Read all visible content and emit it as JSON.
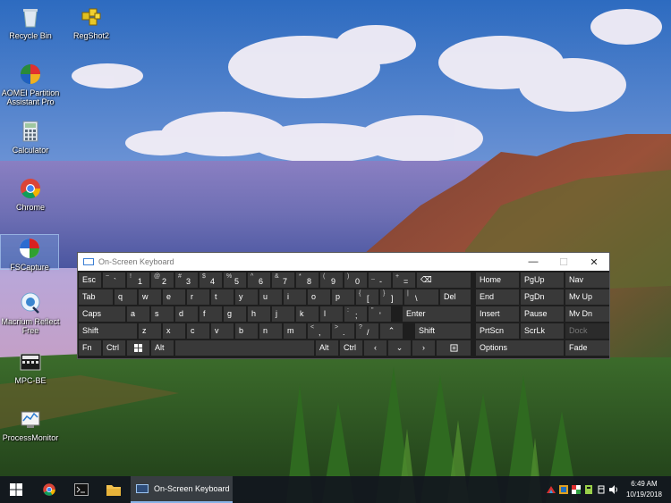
{
  "desktop": {
    "icons": [
      {
        "label": "Recycle Bin"
      },
      {
        "label": "RegShot2"
      },
      {
        "label": "AOMEI Partition Assistant Pro"
      },
      {
        "label": "Calculator"
      },
      {
        "label": "Chrome"
      },
      {
        "label": "FSCapture"
      },
      {
        "label": "Macrium Reflect Free"
      },
      {
        "label": "MPC-BE"
      },
      {
        "label": "ProcessMonitor"
      }
    ]
  },
  "osk": {
    "title": "On-Screen Keyboard",
    "minimize": "—",
    "maximize": "☐",
    "close": "✕",
    "row1": [
      {
        "shift": "~",
        "primary": "`"
      },
      {
        "shift": "!",
        "primary": "1"
      },
      {
        "shift": "@",
        "primary": "2"
      },
      {
        "shift": "#",
        "primary": "3"
      },
      {
        "shift": "$",
        "primary": "4"
      },
      {
        "shift": "%",
        "primary": "5"
      },
      {
        "shift": "^",
        "primary": "6"
      },
      {
        "shift": "&",
        "primary": "7"
      },
      {
        "shift": "*",
        "primary": "8"
      },
      {
        "shift": "(",
        "primary": "9"
      },
      {
        "shift": ")",
        "primary": "0"
      },
      {
        "shift": "_",
        "primary": "-"
      },
      {
        "shift": "+",
        "primary": "="
      }
    ],
    "esc": "Esc",
    "backspace": "⌫",
    "tab": "Tab",
    "row2": [
      "q",
      "w",
      "e",
      "r",
      "t",
      "y",
      "u",
      "i",
      "o",
      "p"
    ],
    "bracket_l": {
      "shift": "{",
      "primary": "["
    },
    "bracket_r": {
      "shift": "}",
      "primary": "]"
    },
    "backslash": {
      "shift": "|",
      "primary": "\\"
    },
    "del": "Del",
    "caps": "Caps",
    "row3": [
      "a",
      "s",
      "d",
      "f",
      "g",
      "h",
      "j",
      "k",
      "l"
    ],
    "semicolon": {
      "shift": ":",
      "primary": ";"
    },
    "quote": {
      "shift": "\"",
      "primary": "'"
    },
    "enter": "Enter",
    "shift": "Shift",
    "row4": [
      "z",
      "x",
      "c",
      "v",
      "b",
      "n",
      "m"
    ],
    "comma": {
      "shift": "<",
      "primary": ","
    },
    "period": {
      "shift": ">",
      "primary": "."
    },
    "slash": {
      "shift": "?",
      "primary": "/"
    },
    "up": "⌃",
    "fn": "Fn",
    "ctrl": "Ctrl",
    "alt": "Alt",
    "left": "‹",
    "down": "⌄",
    "right": "›",
    "nav": {
      "home": "Home",
      "pgup": "PgUp",
      "nav": "Nav",
      "end": "End",
      "pgdn": "PgDn",
      "mvup": "Mv Up",
      "insert": "Insert",
      "pause": "Pause",
      "mvdn": "Mv Dn",
      "prtscn": "PrtScn",
      "scrlk": "ScrLk",
      "dock": "Dock",
      "options": "Options",
      "fade": "Fade"
    }
  },
  "taskbar": {
    "active_app": "On-Screen Keyboard",
    "time": "6:49 AM",
    "date": "10/19/2018"
  }
}
